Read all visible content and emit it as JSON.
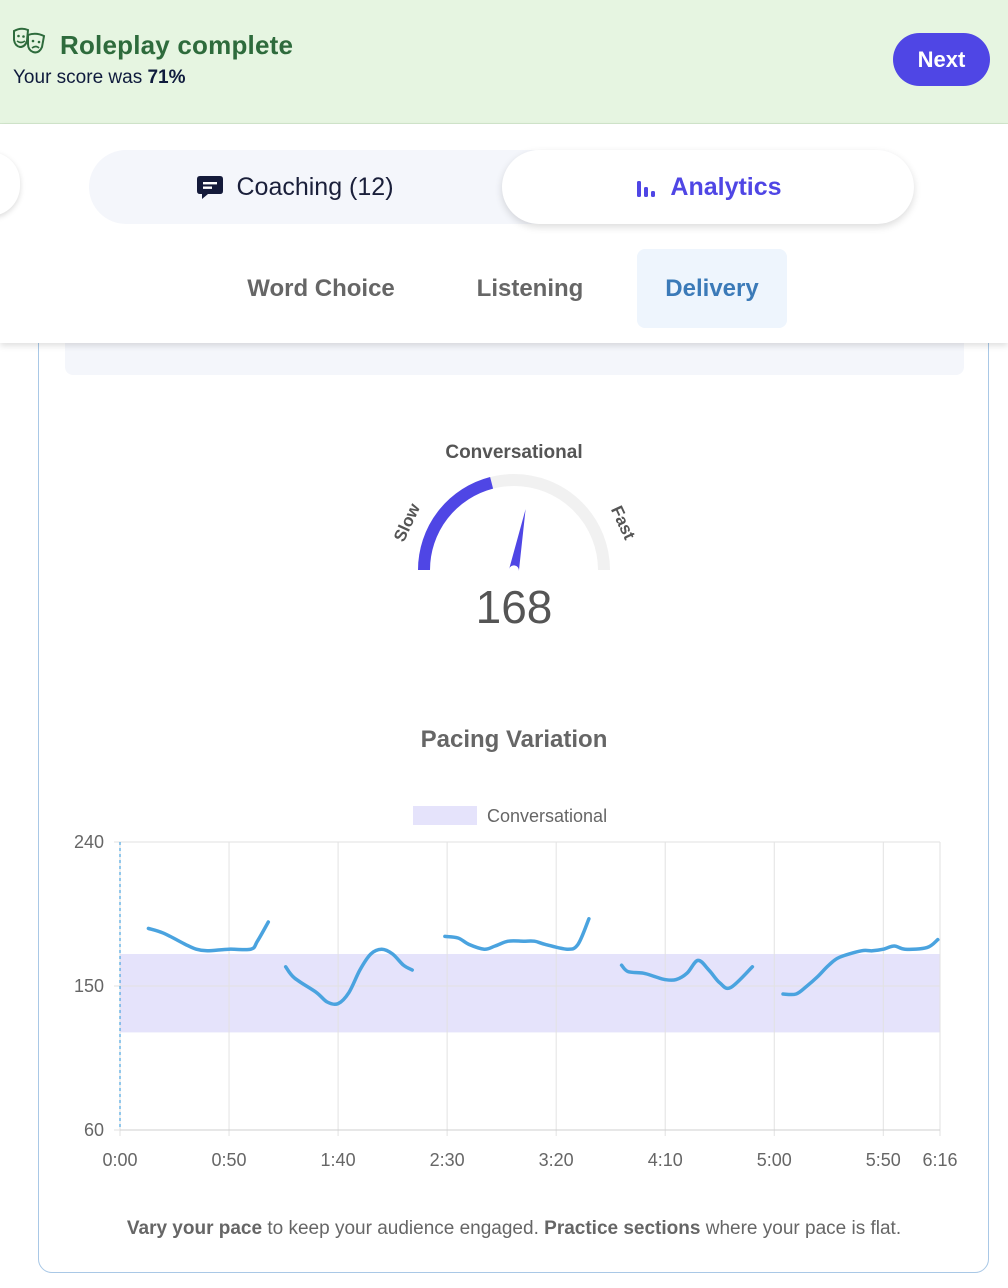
{
  "banner": {
    "icon": "theater-masks-icon",
    "title": "Roleplay complete",
    "score_prefix": "Your score was",
    "score_value": "71%",
    "next_label": "Next",
    "background": "#e6f5e1",
    "title_color": "#2e6b3c"
  },
  "tabs": {
    "coaching": {
      "icon": "chat-bubble-icon",
      "label": "Coaching (12)"
    },
    "analytics": {
      "icon": "bar-chart-icon",
      "label": "Analytics",
      "active": true
    },
    "accent": "#4f46e5"
  },
  "subtabs": [
    {
      "label": "Word Choice"
    },
    {
      "label": "Listening"
    },
    {
      "label": "Delivery",
      "active": true
    }
  ],
  "gauge": {
    "title": "Conversational",
    "left_label": "Slow",
    "right_label": "Fast",
    "value": "168",
    "fill_fraction": 0.42,
    "needle_fraction": 0.56
  },
  "chart_data": {
    "type": "line",
    "title": "Pacing Variation",
    "legend": [
      {
        "name": "Conversational",
        "color": "#e5e3fb"
      }
    ],
    "band": {
      "name": "Conversational",
      "y_min": 121,
      "y_max": 170
    },
    "ylim": [
      60,
      240
    ],
    "y_ticks": [
      "240",
      "150",
      "60"
    ],
    "xlim": [
      0,
      376
    ],
    "x_tick_values": [
      0,
      50,
      100,
      150,
      200,
      250,
      300,
      350,
      376
    ],
    "x_ticks": [
      "0:00",
      "0:50",
      "1:40",
      "2:30",
      "3:20",
      "4:10",
      "5:00",
      "5:50",
      "6:16"
    ],
    "line_color": "#4aa3df",
    "series": [
      {
        "x": [
          13,
          20,
          30,
          35,
          40,
          50,
          60,
          63,
          68
        ],
        "y": [
          186,
          183,
          176,
          173,
          172,
          173,
          173,
          178,
          190
        ]
      },
      {
        "x": [
          76,
          80,
          90,
          95,
          100,
          105,
          110,
          115,
          120,
          125,
          130,
          134
        ],
        "y": [
          162,
          155,
          146,
          140,
          139,
          146,
          160,
          170,
          173,
          170,
          163,
          160
        ]
      },
      {
        "x": [
          149,
          155,
          160,
          167,
          172,
          178,
          185,
          190,
          195,
          205,
          210,
          215
        ],
        "y": [
          181,
          180,
          176,
          173,
          175,
          178,
          178,
          178,
          176,
          173,
          176,
          192
        ]
      },
      {
        "x": [
          230,
          233,
          240,
          245,
          250,
          255,
          260,
          265,
          270,
          275,
          280,
          290
        ],
        "y": [
          163,
          159,
          158,
          156,
          154,
          154,
          158,
          166,
          160,
          152,
          149,
          162
        ]
      },
      {
        "x": [
          304,
          310,
          315,
          320,
          325,
          330,
          340,
          345,
          350,
          355,
          360,
          370,
          375
        ],
        "y": [
          145,
          145,
          150,
          156,
          163,
          168,
          172,
          172,
          173,
          175,
          173,
          174,
          179
        ]
      }
    ]
  },
  "footer": {
    "bold1": "Vary your pace",
    "text1": " to keep your audience engaged. ",
    "bold2": "Practice sections",
    "text2": " where your pace is flat."
  }
}
